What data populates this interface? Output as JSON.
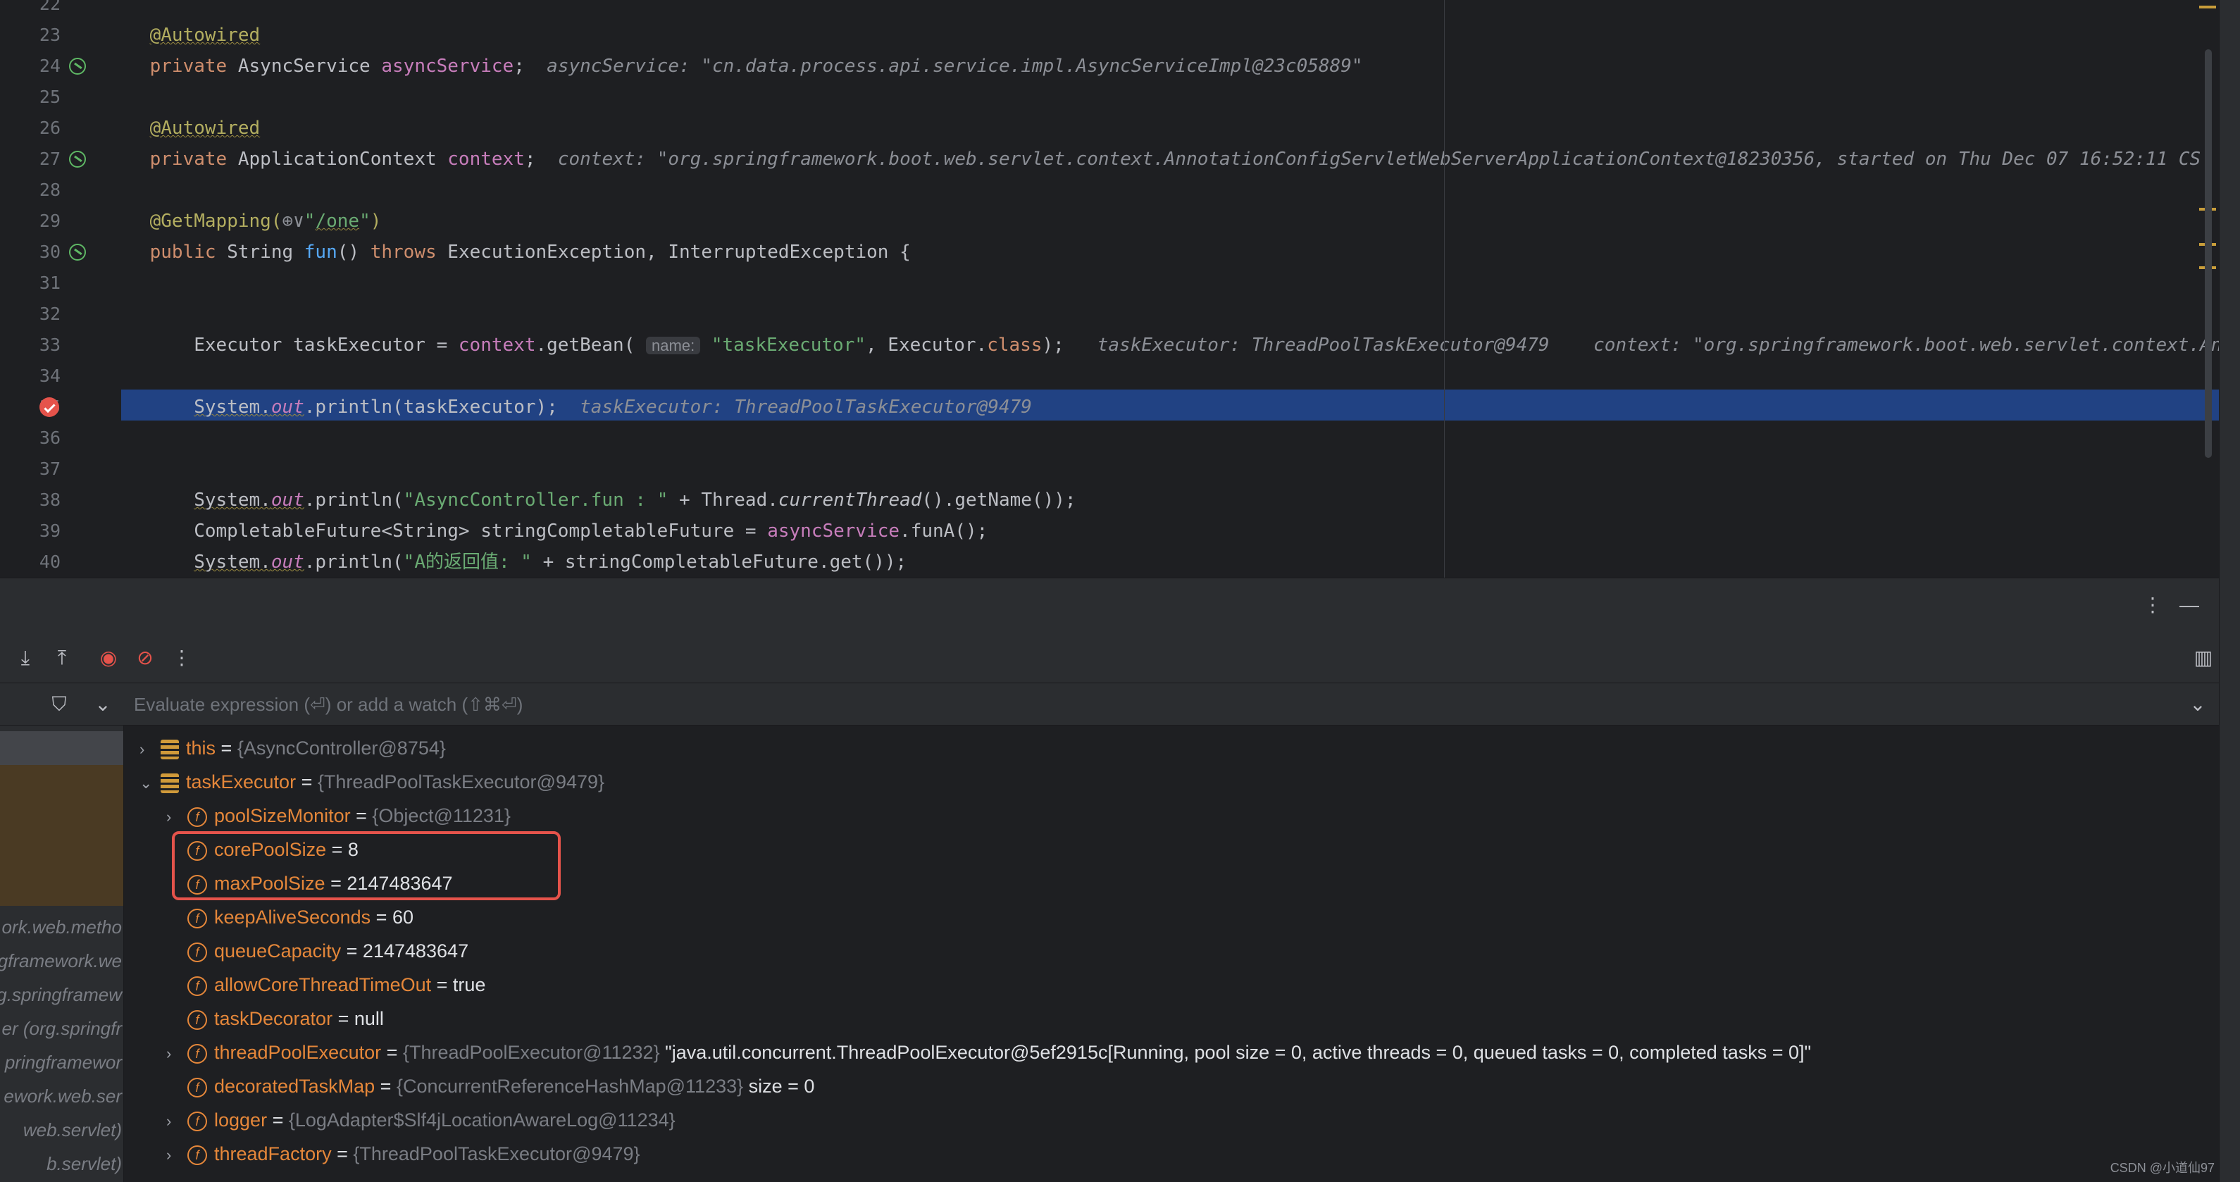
{
  "editor": {
    "lines": [
      {
        "num": "22",
        "segments": []
      },
      {
        "num": "23",
        "segments": [
          {
            "t": "    ",
            "c": ""
          },
          {
            "t": "@Autowired",
            "c": "an und"
          }
        ]
      },
      {
        "num": "24",
        "gutter": "bean",
        "segments": [
          {
            "t": "    ",
            "c": ""
          },
          {
            "t": "private ",
            "c": "kw"
          },
          {
            "t": "AsyncService ",
            "c": "cls"
          },
          {
            "t": "asyncService",
            "c": "fld"
          },
          {
            "t": ";  ",
            "c": ""
          },
          {
            "t": "asyncService: \"cn.data.process.api.service.impl.AsyncServiceImpl@23c05889\"",
            "c": "hint"
          }
        ]
      },
      {
        "num": "25",
        "segments": []
      },
      {
        "num": "26",
        "segments": [
          {
            "t": "    ",
            "c": ""
          },
          {
            "t": "@Autowired",
            "c": "an und"
          }
        ]
      },
      {
        "num": "27",
        "gutter": "bean",
        "segments": [
          {
            "t": "    ",
            "c": ""
          },
          {
            "t": "private ",
            "c": "kw"
          },
          {
            "t": "ApplicationContext ",
            "c": "cls"
          },
          {
            "t": "context",
            "c": "fld"
          },
          {
            "t": ";  ",
            "c": ""
          },
          {
            "t": "context: \"org.springframework.boot.web.servlet.context.AnnotationConfigServletWebServerApplicationContext@18230356, started on Thu Dec 07 16:52:11 CS",
            "c": "hint"
          }
        ]
      },
      {
        "num": "28",
        "segments": []
      },
      {
        "num": "29",
        "segments": [
          {
            "t": "    ",
            "c": ""
          },
          {
            "t": "@GetMapping(",
            "c": "an"
          },
          {
            "t": "⊕∨",
            "c": "hint"
          },
          {
            "t": "\"",
            "c": "st"
          },
          {
            "t": "/one",
            "c": "st und"
          },
          {
            "t": "\"",
            "c": "st"
          },
          {
            "t": ")",
            "c": "an"
          }
        ]
      },
      {
        "num": "30",
        "gutter": "web",
        "segments": [
          {
            "t": "    ",
            "c": ""
          },
          {
            "t": "public ",
            "c": "kw"
          },
          {
            "t": "String ",
            "c": "cls"
          },
          {
            "t": "fun",
            "c": "fn"
          },
          {
            "t": "() ",
            "c": ""
          },
          {
            "t": "throws ",
            "c": "kw"
          },
          {
            "t": "ExecutionException, InterruptedException {",
            "c": ""
          }
        ]
      },
      {
        "num": "31",
        "segments": []
      },
      {
        "num": "32",
        "segments": []
      },
      {
        "num": "33",
        "segments": [
          {
            "t": "        Executor taskExecutor = ",
            "c": ""
          },
          {
            "t": "context",
            "c": "fld"
          },
          {
            "t": ".getBean( ",
            "c": ""
          },
          {
            "t": "name:",
            "c": "pill"
          },
          {
            "t": " \"taskExecutor\"",
            "c": "st"
          },
          {
            "t": ", Executor.",
            "c": ""
          },
          {
            "t": "class",
            "c": "kw"
          },
          {
            "t": ");   ",
            "c": ""
          },
          {
            "t": "taskExecutor: ThreadPoolTaskExecutor@9479    context: \"org.springframework.boot.web.servlet.context.An",
            "c": "hint"
          }
        ]
      },
      {
        "num": "34",
        "segments": []
      },
      {
        "num": "35",
        "gutter": "breakpoint",
        "segments": [
          {
            "t": "        ",
            "c": ""
          },
          {
            "t": "System.",
            "c": "und"
          },
          {
            "t": "out",
            "c": "fld it und"
          },
          {
            "t": ".println(taskExecutor);  ",
            "c": ""
          },
          {
            "t": "taskExecutor: ThreadPoolTaskExecutor@9479",
            "c": "hint"
          }
        ]
      },
      {
        "num": "36",
        "segments": []
      },
      {
        "num": "37",
        "segments": []
      },
      {
        "num": "38",
        "segments": [
          {
            "t": "        ",
            "c": ""
          },
          {
            "t": "System.",
            "c": "und"
          },
          {
            "t": "out",
            "c": "fld it und"
          },
          {
            "t": ".println(",
            "c": ""
          },
          {
            "t": "\"AsyncController.fun : \"",
            "c": "st"
          },
          {
            "t": " + Thread.",
            "c": ""
          },
          {
            "t": "currentThread",
            "c": "it"
          },
          {
            "t": "().getName());",
            "c": ""
          }
        ]
      },
      {
        "num": "39",
        "segments": [
          {
            "t": "        CompletableFuture<String> stringCompletableFuture = ",
            "c": ""
          },
          {
            "t": "asyncService",
            "c": "fld"
          },
          {
            "t": ".funA();",
            "c": ""
          }
        ]
      },
      {
        "num": "40",
        "segments": [
          {
            "t": "        ",
            "c": ""
          },
          {
            "t": "System.",
            "c": "und"
          },
          {
            "t": "out",
            "c": "fld it und"
          },
          {
            "t": ".println(",
            "c": ""
          },
          {
            "t": "\"A的返回值: \"",
            "c": "st"
          },
          {
            "t": " + stringCompletableFuture.get());",
            "c": ""
          }
        ]
      }
    ]
  },
  "panel": {
    "more_icon": "⋮",
    "minimize_icon": "—",
    "layout_icon": "▥"
  },
  "toolbar": {
    "step_into_icon": "⤓",
    "step_out_icon": "⤒",
    "view_breakpoints_icon": "◉",
    "mute_breakpoints_icon": "⊘",
    "more_icon": "⋮"
  },
  "eval": {
    "filter_icon": "⛉",
    "dropdown_icon": "⌄",
    "placeholder": "Evaluate expression (⏎) or add a watch (⇧⌘⏎)",
    "expand_icon": "⌄"
  },
  "frames": [
    "ork.web.metho",
    "gframework.we",
    "g.springframew",
    "er (org.springfr",
    "pringframewor",
    "ework.web.ser",
    "web.servlet)",
    "b.servlet)"
  ],
  "variables": [
    {
      "indent": 0,
      "chev": "›",
      "icon": "obj",
      "name": "this",
      "eq": " = ",
      "ref": "{AsyncController@8754}",
      "val": ""
    },
    {
      "indent": 0,
      "chev": "⌄",
      "icon": "obj",
      "name": "taskExecutor",
      "eq": " = ",
      "ref": "{ThreadPoolTaskExecutor@9479}",
      "val": ""
    },
    {
      "indent": 1,
      "chev": "›",
      "icon": "f",
      "name": "poolSizeMonitor",
      "eq": " = ",
      "ref": "{Object@11231}",
      "val": ""
    },
    {
      "indent": 1,
      "chev": "",
      "icon": "f",
      "name": "corePoolSize",
      "eq": " = ",
      "ref": "",
      "val": "8"
    },
    {
      "indent": 1,
      "chev": "",
      "icon": "f",
      "name": "maxPoolSize",
      "eq": " = ",
      "ref": "",
      "val": "2147483647"
    },
    {
      "indent": 1,
      "chev": "",
      "icon": "f",
      "name": "keepAliveSeconds",
      "eq": " = ",
      "ref": "",
      "val": "60"
    },
    {
      "indent": 1,
      "chev": "",
      "icon": "f",
      "name": "queueCapacity",
      "eq": " = ",
      "ref": "",
      "val": "2147483647"
    },
    {
      "indent": 1,
      "chev": "",
      "icon": "f",
      "name": "allowCoreThreadTimeOut",
      "eq": " = ",
      "ref": "",
      "val": "true"
    },
    {
      "indent": 1,
      "chev": "",
      "icon": "f",
      "name": "taskDecorator",
      "eq": " = ",
      "ref": "",
      "val": "null"
    },
    {
      "indent": 1,
      "chev": "›",
      "icon": "f",
      "name": "threadPoolExecutor",
      "eq": " = ",
      "ref": "{ThreadPoolExecutor@11232}",
      "val": " \"java.util.concurrent.ThreadPoolExecutor@5ef2915c[Running, pool size = 0, active threads = 0, queued tasks = 0, completed tasks = 0]\""
    },
    {
      "indent": 1,
      "chev": "",
      "icon": "f",
      "name": "decoratedTaskMap",
      "eq": " = ",
      "ref": "{ConcurrentReferenceHashMap@11233}",
      "val": "  size = 0"
    },
    {
      "indent": 1,
      "chev": "›",
      "icon": "f",
      "name": "logger",
      "eq": " = ",
      "ref": "{LogAdapter$Slf4jLocationAwareLog@11234}",
      "val": ""
    },
    {
      "indent": 1,
      "chev": "›",
      "icon": "f",
      "name": "threadFactory",
      "eq": " = ",
      "ref": "{ThreadPoolTaskExecutor@9479}",
      "val": ""
    }
  ],
  "watermark": "CSDN @小道仙97"
}
